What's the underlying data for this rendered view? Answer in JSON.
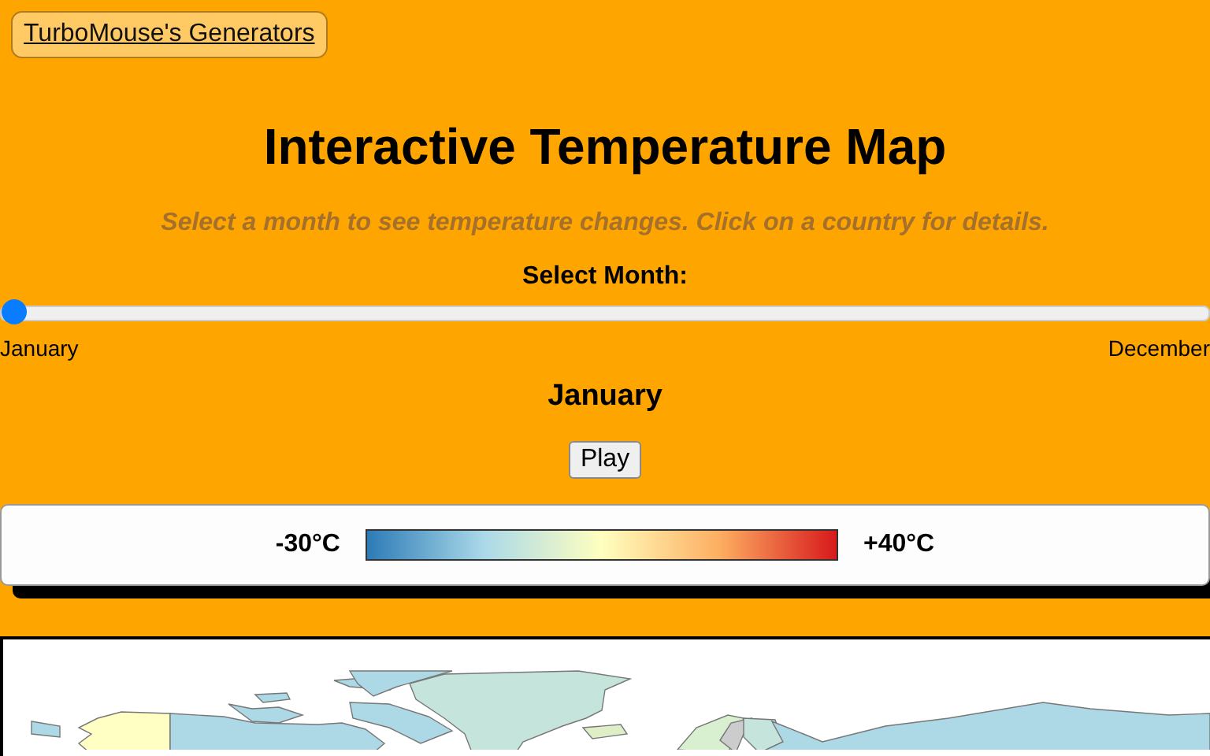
{
  "nav_link": "TurboMouse's Generators",
  "title": "Interactive Temperature Map",
  "subtitle": "Select a month to see temperature changes. Click on a country for details.",
  "slider": {
    "label": "Select Month:",
    "level": 0,
    "min_label": "January",
    "max_label": "December"
  },
  "current_month": "January",
  "play_button": "Play",
  "legend": {
    "min_label": "-30°C",
    "max_label": "+40°C"
  }
}
